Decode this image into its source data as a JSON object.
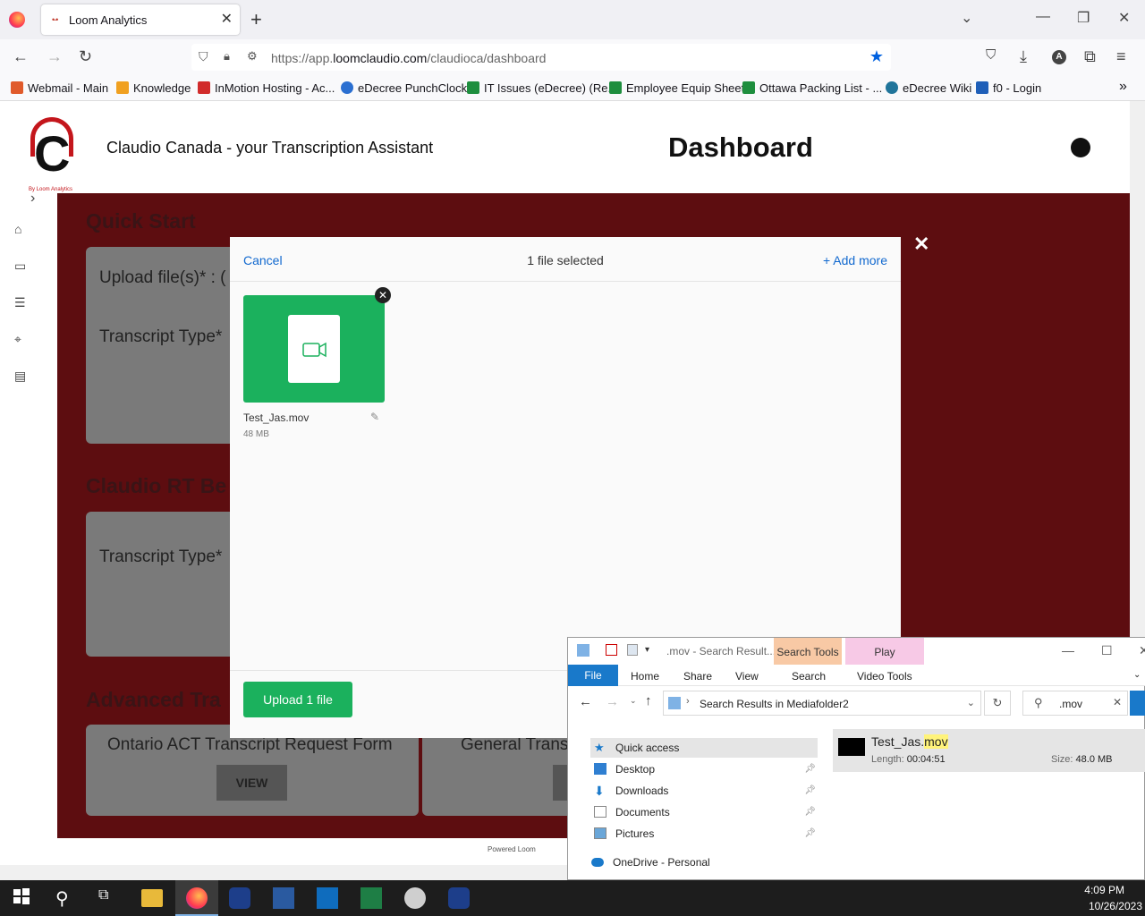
{
  "browser": {
    "tab_title": "Loom Analytics",
    "url_prefix": "https://app.",
    "url_domain": "loomclaudio.com",
    "url_path": "/claudioca/dashboard",
    "bookmarks": [
      {
        "label": "Webmail - Main",
        "color": "#e05a2b"
      },
      {
        "label": "Knowledge",
        "color": "#f0a020"
      },
      {
        "label": "InMotion Hosting - Ac...",
        "color": "#d12b2b"
      },
      {
        "label": "eDecree PunchClock",
        "color": "#2b6fd1"
      },
      {
        "label": "IT Issues (eDecree) (Re...",
        "color": "#1e8e3e"
      },
      {
        "label": "Employee Equip Sheet",
        "color": "#1e8e3e"
      },
      {
        "label": "Ottawa Packing List - ...",
        "color": "#1e8e3e"
      },
      {
        "label": "eDecree Wiki",
        "color": "#21759b"
      },
      {
        "label": "f0 - Login",
        "color": "#1f5fb8"
      }
    ]
  },
  "app": {
    "tagline": "Claudio Canada - your Transcription Assistant",
    "title": "Dashboard",
    "logo_letter": "C",
    "logo_by": "By Loom Analytics",
    "sections": {
      "quick_start": "Quick Start",
      "upload_label": "Upload file(s)* : (",
      "transcript_type": "Transcript Type*",
      "claudio_rt": "Claudio RT Be",
      "transcript_type2": "Transcript Type*",
      "advanced": "Advanced Tra",
      "ontario_form": "Ontario ACT Transcript Request Form",
      "general_form": "General Trans",
      "view": "VIEW",
      "powered": "Powered Loom"
    }
  },
  "modal": {
    "cancel": "Cancel",
    "count": "1 file selected",
    "add_more": "+ Add more",
    "file_name": "Test_Jas.mov",
    "file_size": "48 MB",
    "upload_button": "Upload 1 file"
  },
  "explorer": {
    "title": ".mov - Search Result...",
    "search_tools": "Search Tools",
    "play": "Play",
    "tabs": {
      "file": "File",
      "home": "Home",
      "share": "Share",
      "view": "View",
      "search": "Search",
      "video_tools": "Video Tools"
    },
    "path": "Search Results in Mediafolder2",
    "search_value": ".mov",
    "nav": {
      "quick_access": "Quick access",
      "desktop": "Desktop",
      "downloads": "Downloads",
      "documents": "Documents",
      "pictures": "Pictures",
      "onedrive": "OneDrive - Personal"
    },
    "result": {
      "name_base": "Test_Jas.",
      "name_ext": "mov",
      "length_label": "Length:",
      "length": "00:04:51",
      "size_label": "Size:",
      "size": "48.0 MB"
    }
  },
  "taskbar": {
    "time": "4:09 PM",
    "date": "10/26/2023"
  }
}
